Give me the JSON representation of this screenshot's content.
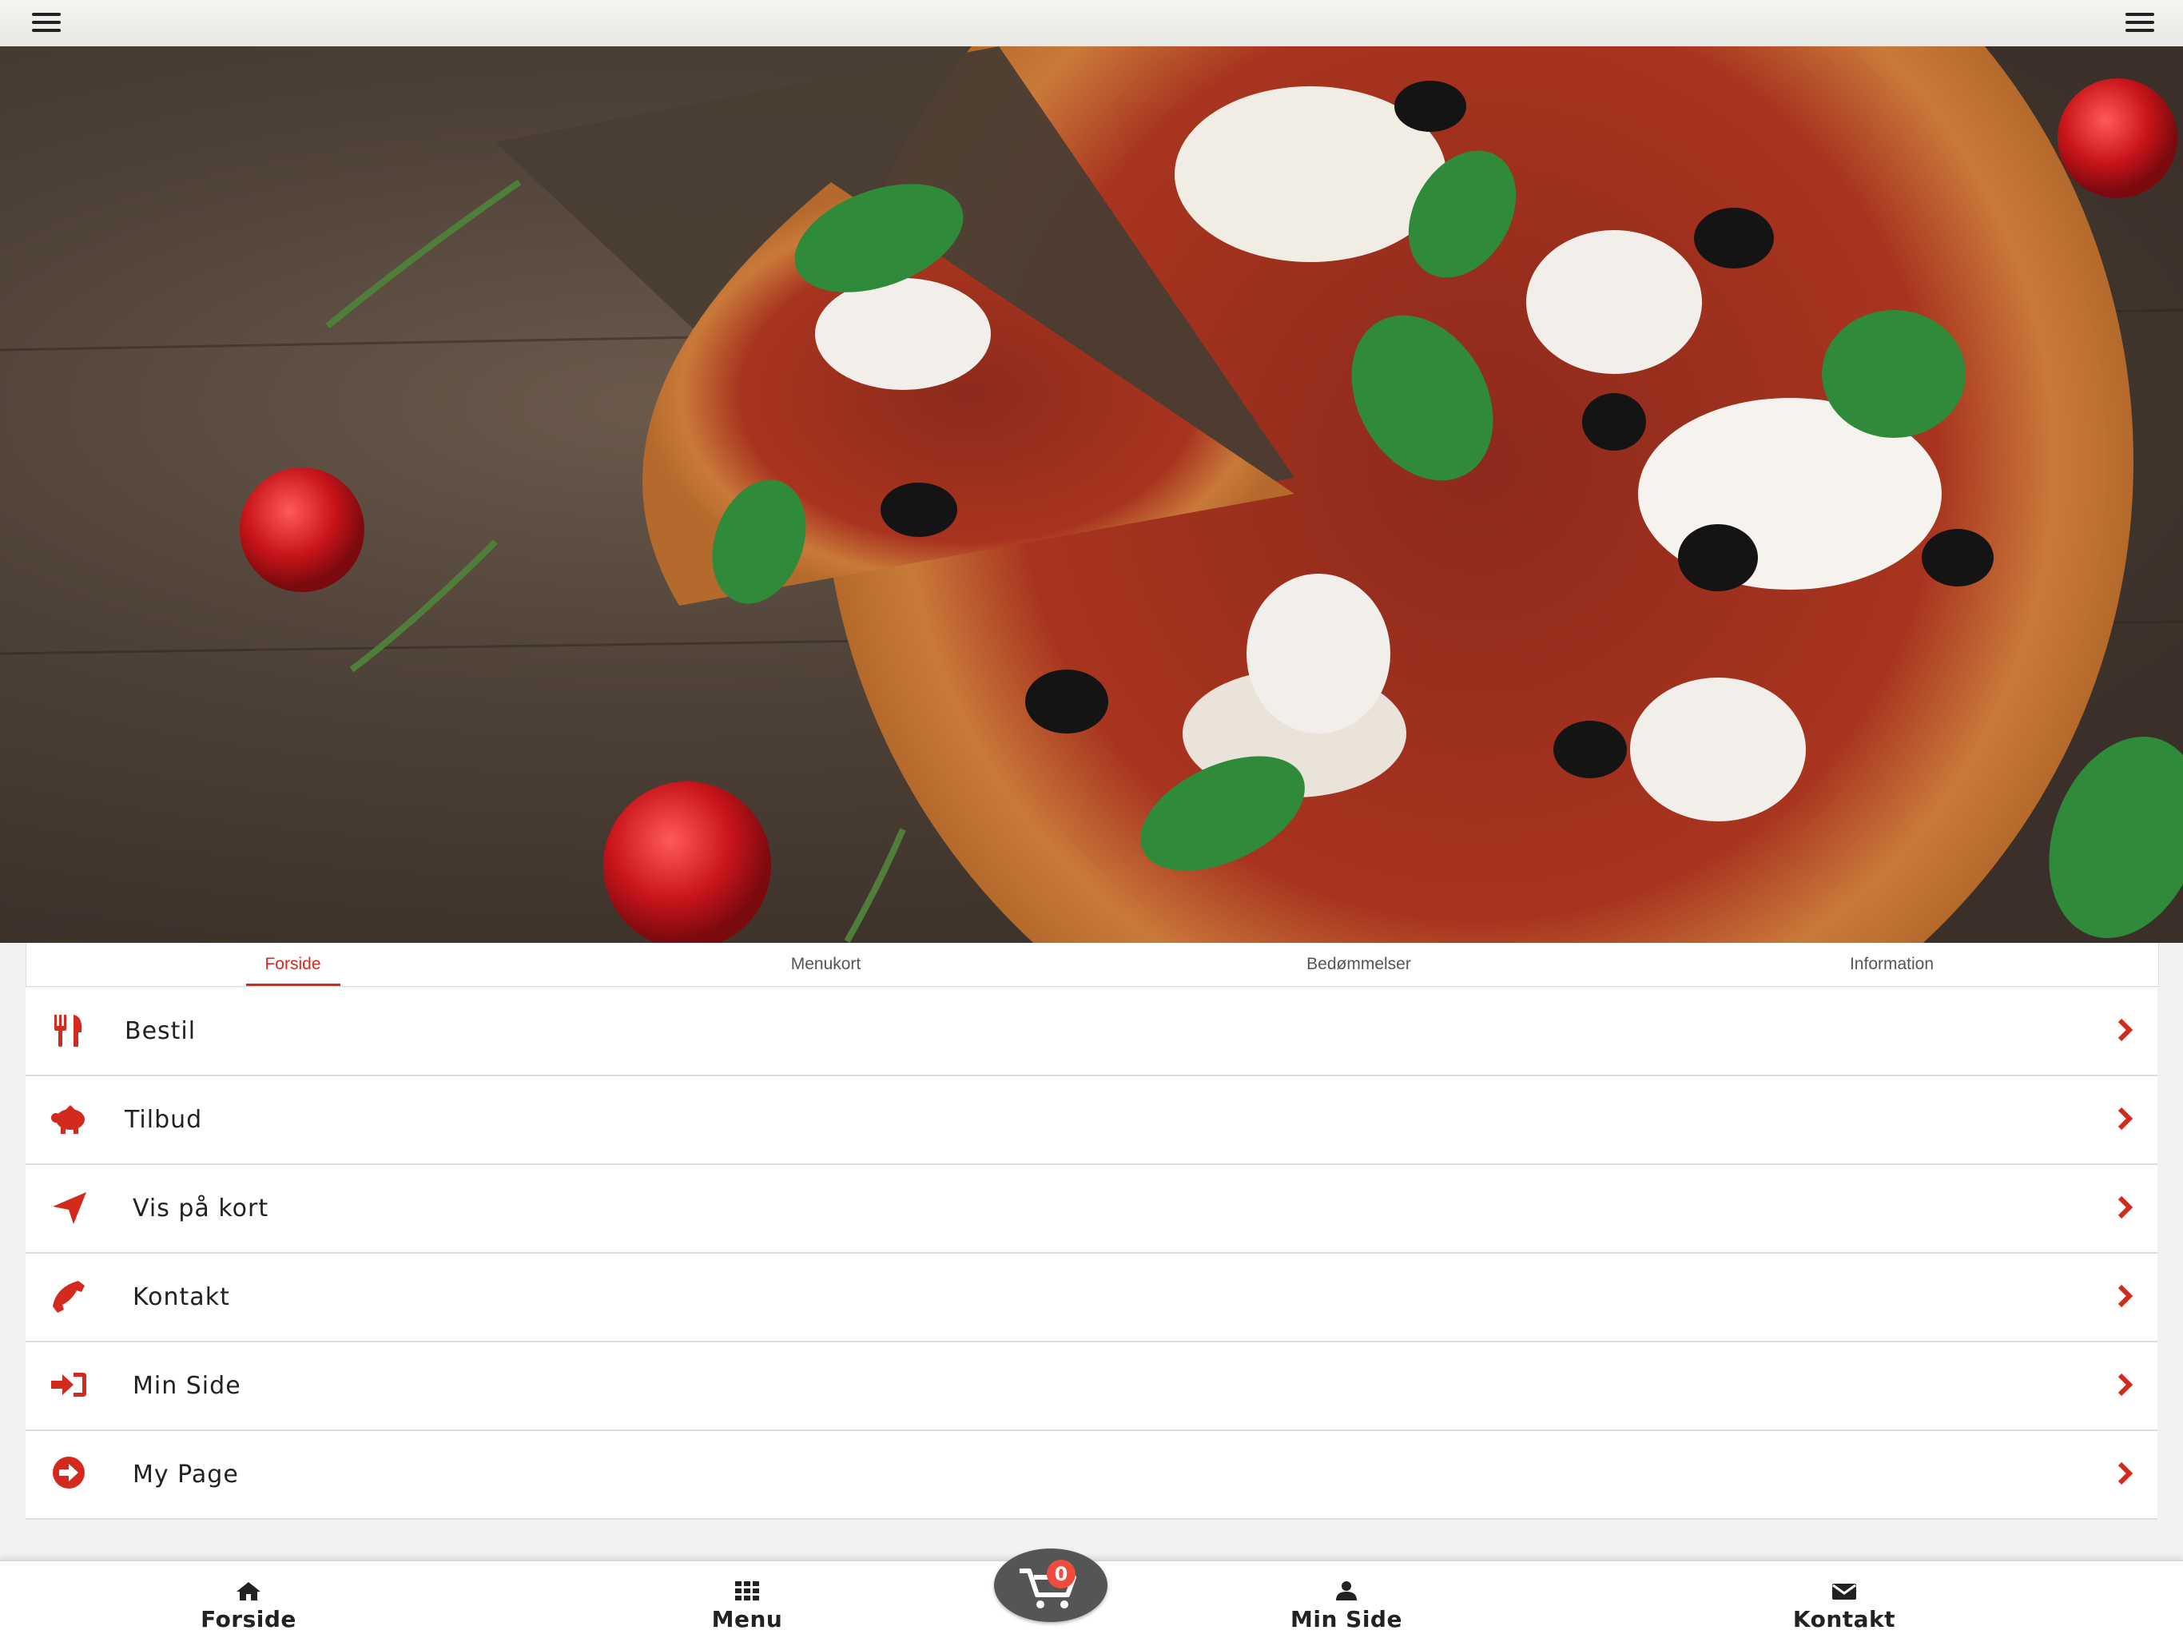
{
  "tabs": [
    {
      "label": "Forside",
      "active": true
    },
    {
      "label": "Menukort"
    },
    {
      "label": "Bedømmelser"
    },
    {
      "label": "Information"
    }
  ],
  "menu_items": [
    {
      "label": "Bestil",
      "icon": "cutlery-icon"
    },
    {
      "label": "Tilbud",
      "icon": "piggy-bank-icon"
    },
    {
      "label": "Vis på kort",
      "icon": "location-arrow-icon"
    },
    {
      "label": "Kontakt",
      "icon": "phone-icon"
    },
    {
      "label": "Min Side",
      "icon": "sign-in-icon"
    },
    {
      "label": "My Page",
      "icon": "arrow-circle-right-icon"
    }
  ],
  "bottom_nav": [
    {
      "label": "Forside",
      "icon": "home-icon"
    },
    {
      "label": "Menu",
      "icon": "grid-icon"
    },
    {
      "label": "Min Side",
      "icon": "user-icon"
    },
    {
      "label": "Kontakt",
      "icon": "envelope-icon"
    }
  ],
  "cart": {
    "count": "0",
    "icon": "shopping-cart-icon"
  },
  "colors": {
    "accent": "#d32a1e",
    "text": "#222222",
    "badge": "#ef4b3f",
    "cart_bg": "#555555"
  }
}
